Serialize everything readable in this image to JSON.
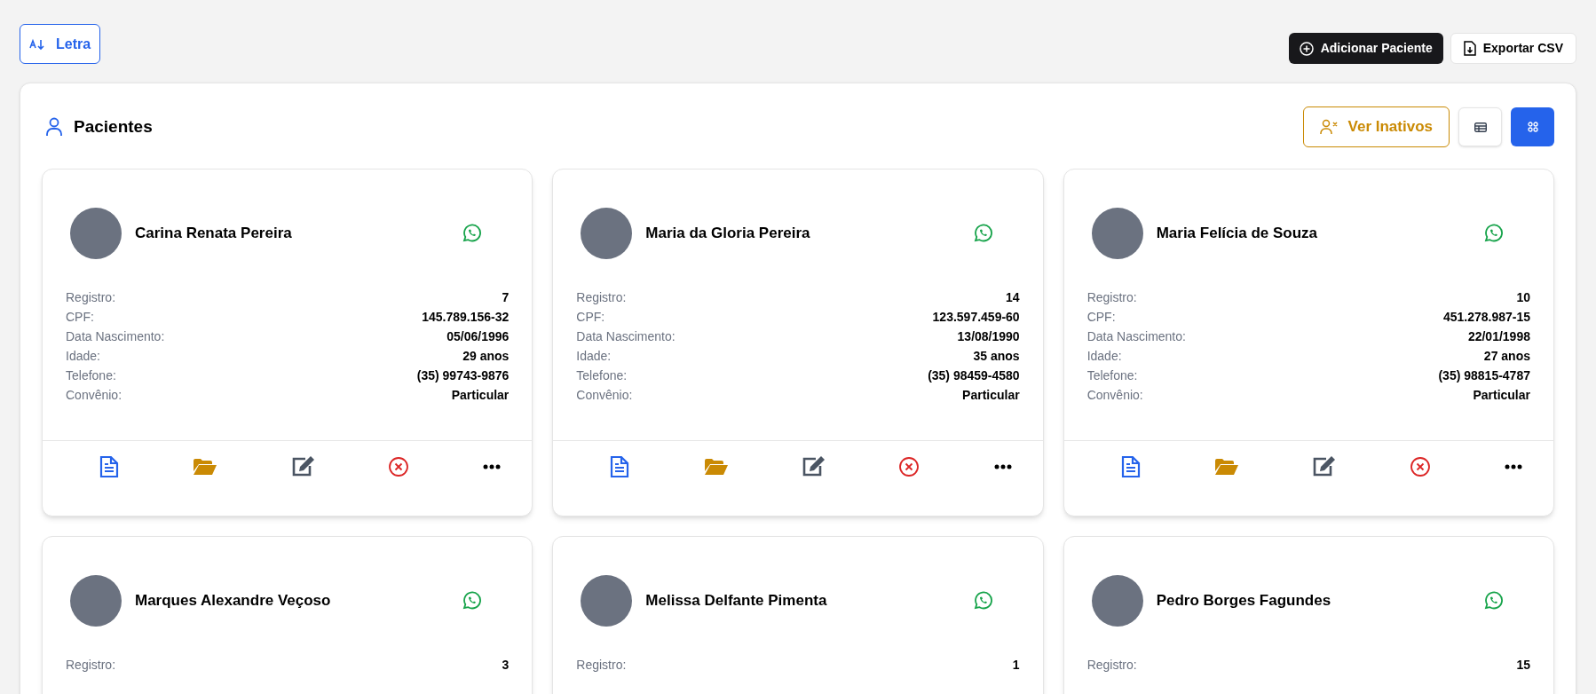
{
  "sort_button": {
    "label": "Letra"
  },
  "actions": [
    {
      "kind": "add",
      "label": "Adicionar Paciente"
    },
    {
      "kind": "export",
      "label": "Exportar CSV"
    }
  ],
  "panel": {
    "title": "Pacientes",
    "inactive_button": "Ver Inativos",
    "views": [
      {
        "kind": "table",
        "selected": false
      },
      {
        "kind": "grid",
        "selected": true
      }
    ]
  },
  "patients": [
    {
      "name": "Carina Renata Pereira",
      "fields": [
        {
          "label": "Registro:",
          "value": "7"
        },
        {
          "label": "CPF:",
          "value": "145.789.156-32"
        },
        {
          "label": "Data Nascimento:",
          "value": "05/06/1996"
        },
        {
          "label": "Idade:",
          "value": "29 anos"
        },
        {
          "label": "Telefone:",
          "value": "(35) 99743-9876"
        },
        {
          "label": "Convênio:",
          "value": "Particular"
        }
      ]
    },
    {
      "name": "Maria da Gloria Pereira",
      "fields": [
        {
          "label": "Registro:",
          "value": "14"
        },
        {
          "label": "CPF:",
          "value": "123.597.459-60"
        },
        {
          "label": "Data Nascimento:",
          "value": "13/08/1990"
        },
        {
          "label": "Idade:",
          "value": "35 anos"
        },
        {
          "label": "Telefone:",
          "value": "(35) 98459-4580"
        },
        {
          "label": "Convênio:",
          "value": "Particular"
        }
      ]
    },
    {
      "name": "Maria Felícia de Souza",
      "fields": [
        {
          "label": "Registro:",
          "value": "10"
        },
        {
          "label": "CPF:",
          "value": "451.278.987-15"
        },
        {
          "label": "Data Nascimento:",
          "value": "22/01/1998"
        },
        {
          "label": "Idade:",
          "value": "27 anos"
        },
        {
          "label": "Telefone:",
          "value": "(35) 98815-4787"
        },
        {
          "label": "Convênio:",
          "value": "Particular"
        }
      ]
    },
    {
      "name": "Marques Alexandre Veçoso",
      "fields": [
        {
          "label": "Registro:",
          "value": "3"
        }
      ]
    },
    {
      "name": "Melissa Delfante Pimenta",
      "fields": [
        {
          "label": "Registro:",
          "value": "1"
        }
      ]
    },
    {
      "name": "Pedro Borges Fagundes",
      "fields": [
        {
          "label": "Registro:",
          "value": "15"
        }
      ]
    }
  ]
}
